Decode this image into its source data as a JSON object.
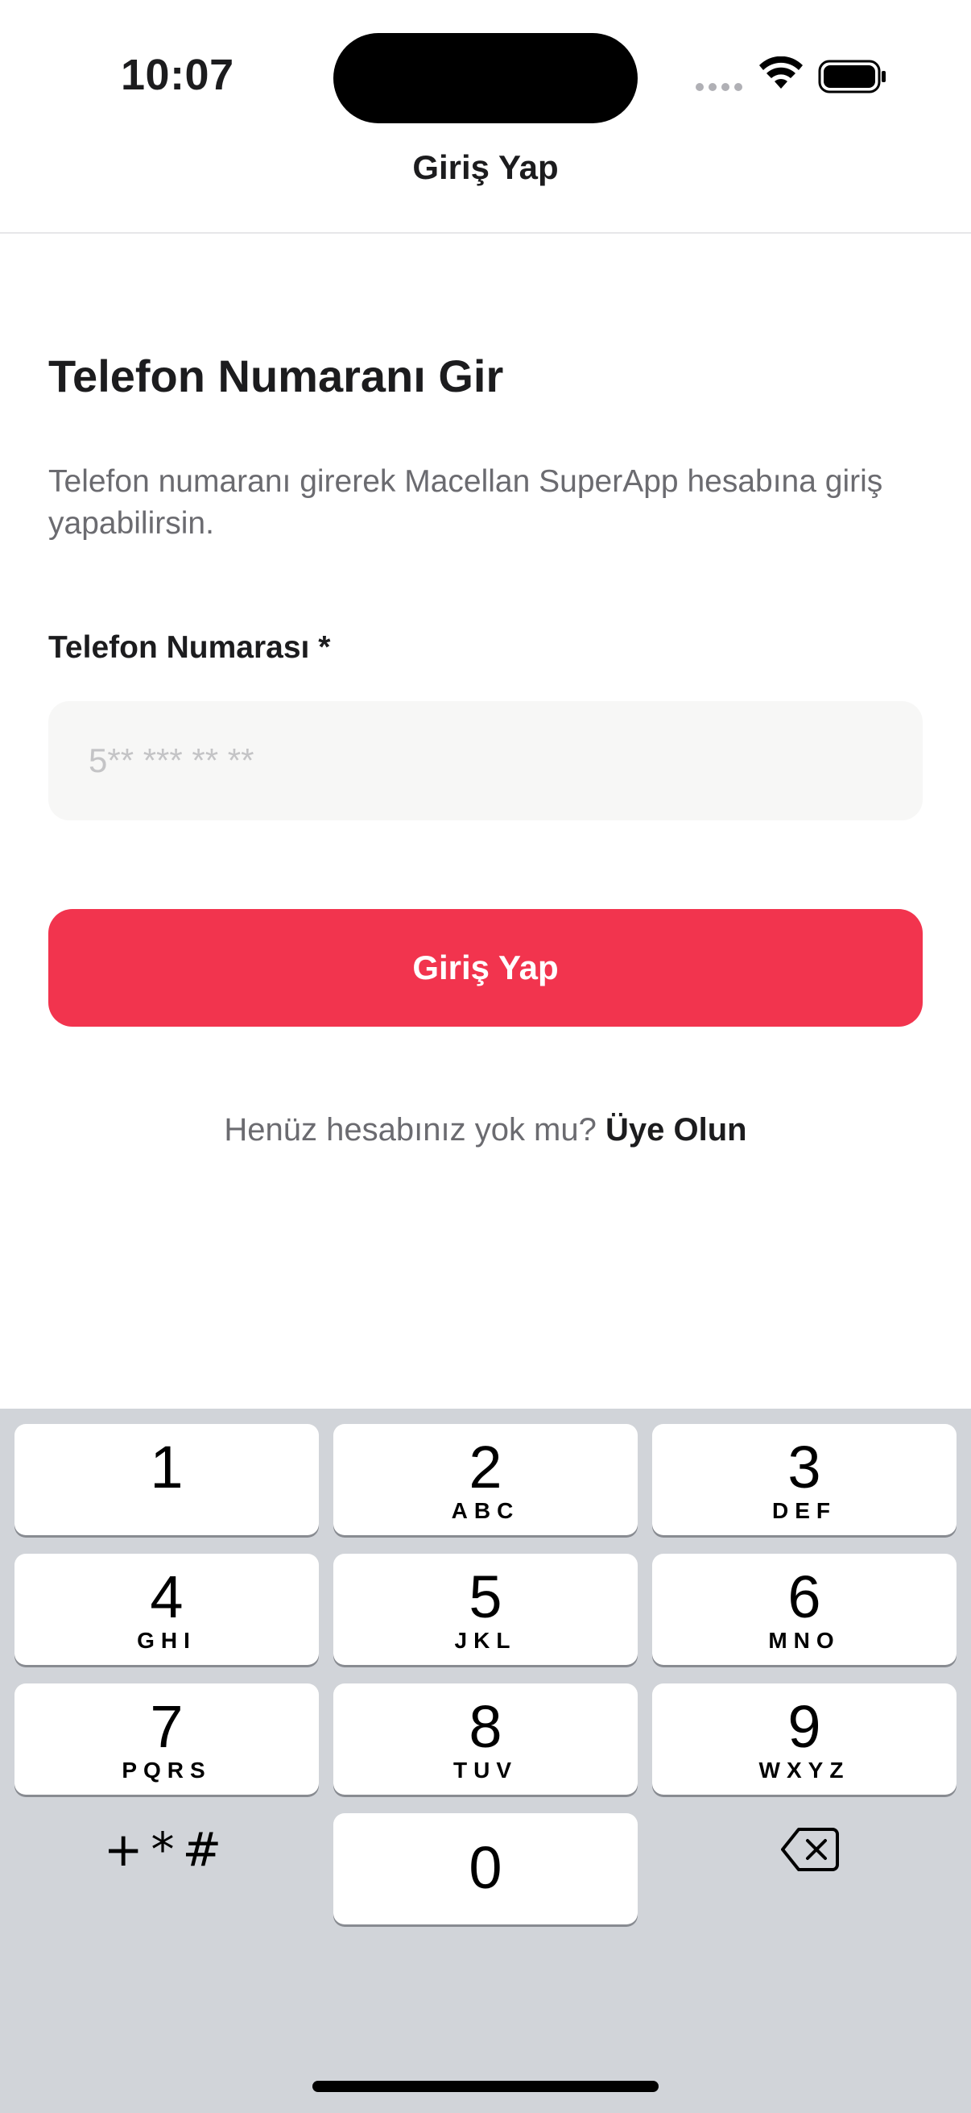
{
  "status_bar": {
    "time": "10:07"
  },
  "nav": {
    "title": "Giriş Yap"
  },
  "main": {
    "heading": "Telefon Numaranı Gir",
    "description": "Telefon numaranı girerek Macellan SuperApp hesabına giriş yapabilirsin.",
    "field_label": "Telefon Numarası *",
    "phone_input": {
      "value": "",
      "placeholder": "5** *** ** **"
    },
    "login_button": "Giriş Yap",
    "signup_prompt": "Henüz hesabınız yok mu?",
    "signup_link": "Üye Olun"
  },
  "keyboard": {
    "keys": [
      {
        "digit": "1",
        "letters": ""
      },
      {
        "digit": "2",
        "letters": "ABC"
      },
      {
        "digit": "3",
        "letters": "DEF"
      },
      {
        "digit": "4",
        "letters": "GHI"
      },
      {
        "digit": "5",
        "letters": "JKL"
      },
      {
        "digit": "6",
        "letters": "MNO"
      },
      {
        "digit": "7",
        "letters": "PQRS"
      },
      {
        "digit": "8",
        "letters": "TUV"
      },
      {
        "digit": "9",
        "letters": "WXYZ"
      },
      {
        "digit": "0",
        "letters": ""
      }
    ],
    "symbols": "+*#",
    "delete_icon": "backspace-icon"
  },
  "colors": {
    "accent": "#f2344e",
    "keyboard_bg": "#d1d4d9",
    "input_bg": "#f7f7f6"
  }
}
